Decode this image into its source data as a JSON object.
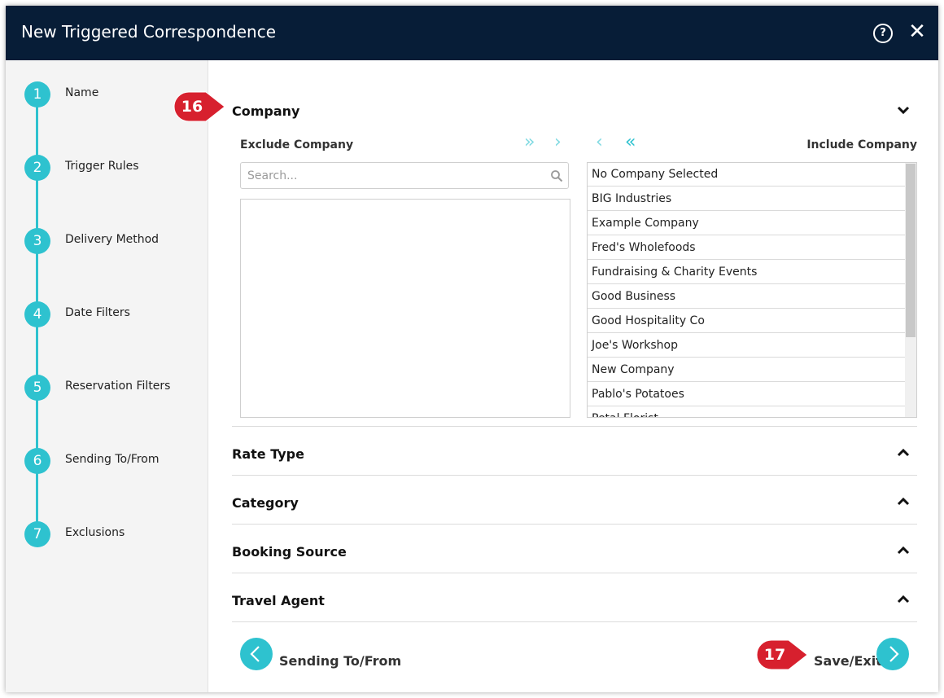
{
  "dialog": {
    "title": "New Triggered Correspondence",
    "help_icon": "help-circle-icon",
    "close_icon": "close-icon"
  },
  "steps": [
    {
      "number": "1",
      "label": "Name"
    },
    {
      "number": "2",
      "label": "Trigger Rules"
    },
    {
      "number": "3",
      "label": "Delivery Method"
    },
    {
      "number": "4",
      "label": "Date Filters"
    },
    {
      "number": "5",
      "label": "Reservation Filters"
    },
    {
      "number": "6",
      "label": "Sending To/From"
    },
    {
      "number": "7",
      "label": "Exclusions"
    }
  ],
  "company": {
    "title": "Company",
    "exclude_label": "Exclude Company",
    "include_label": "Include Company",
    "search_placeholder": "Search...",
    "include_items": [
      "No Company Selected",
      "BIG Industries",
      "Example Company",
      "Fred's Wholefoods",
      "Fundraising & Charity Events",
      "Good Business",
      "Good Hospitality Co",
      "Joe's Workshop",
      "New Company",
      "Pablo's Potatoes",
      "Petal Florist"
    ]
  },
  "collapsed_sections": [
    "Rate Type",
    "Category",
    "Booking Source",
    "Travel Agent"
  ],
  "footer": {
    "back_label": "Sending To/From",
    "save_label": "Save/Exit"
  },
  "callouts": {
    "company": "16",
    "save": "17"
  },
  "colors": {
    "header": "#071d37",
    "accent": "#2ec2cf",
    "callout": "#d7202e"
  }
}
